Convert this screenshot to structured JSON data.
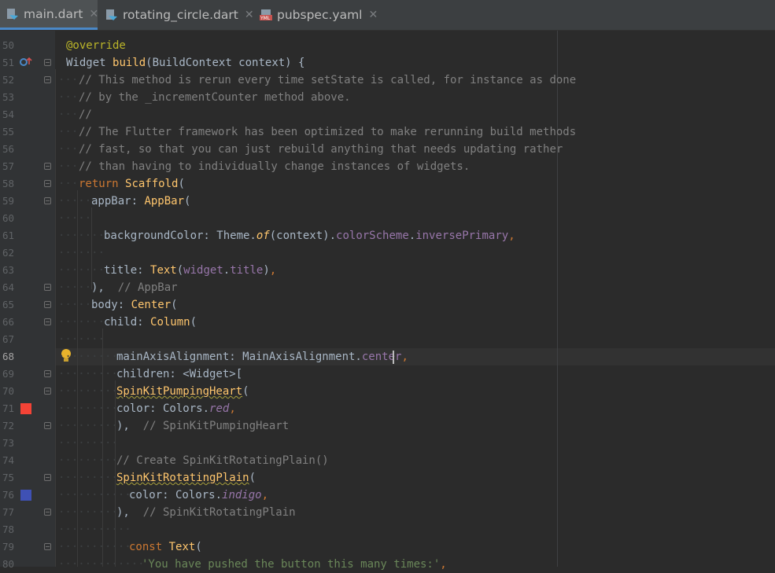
{
  "tabs": [
    {
      "label": "main.dart",
      "active": true,
      "icon": "dart-file-icon"
    },
    {
      "label": "rotating_circle.dart",
      "active": false,
      "icon": "dart-file-icon"
    },
    {
      "label": "pubspec.yaml",
      "active": false,
      "icon": "yaml-file-icon"
    }
  ],
  "editor": {
    "current_line": "68",
    "swatch_colors": {
      "red": "#f44336",
      "indigo": "#3f51b5"
    },
    "lines": [
      {
        "n": "50",
        "code": "@override"
      },
      {
        "n": "51",
        "code": "Widget build(BuildContext context) {"
      },
      {
        "n": "52",
        "code": "// This method is rerun every time setState is called, for instance as done"
      },
      {
        "n": "53",
        "code": "// by the _incrementCounter method above."
      },
      {
        "n": "54",
        "code": "//"
      },
      {
        "n": "55",
        "code": "// The Flutter framework has been optimized to make rerunning build methods"
      },
      {
        "n": "56",
        "code": "// fast, so that you can just rebuild anything that needs updating rather"
      },
      {
        "n": "57",
        "code": "// than having to individually change instances of widgets."
      },
      {
        "n": "58",
        "code": "return Scaffold("
      },
      {
        "n": "59",
        "code": "appBar: AppBar("
      },
      {
        "n": "60",
        "code": ""
      },
      {
        "n": "61",
        "code": "backgroundColor: Theme.of(context).colorScheme.inversePrimary,"
      },
      {
        "n": "62",
        "code": ""
      },
      {
        "n": "63",
        "code": "title: Text(widget.title),"
      },
      {
        "n": "64",
        "code": "),  // AppBar"
      },
      {
        "n": "65",
        "code": "body: Center("
      },
      {
        "n": "66",
        "code": "child: Column("
      },
      {
        "n": "67",
        "code": ""
      },
      {
        "n": "68",
        "code": "mainAxisAlignment: MainAxisAlignment.center,"
      },
      {
        "n": "69",
        "code": "children: <Widget>["
      },
      {
        "n": "70",
        "code": "SpinKitPumpingHeart("
      },
      {
        "n": "71",
        "code": "color: Colors.red,"
      },
      {
        "n": "72",
        "code": "),  // SpinKitPumpingHeart"
      },
      {
        "n": "73",
        "code": ""
      },
      {
        "n": "74",
        "code": "// Create SpinKitRotatingPlain()"
      },
      {
        "n": "75",
        "code": "SpinKitRotatingPlain("
      },
      {
        "n": "76",
        "code": "color: Colors.indigo,"
      },
      {
        "n": "77",
        "code": "),  // SpinKitRotatingPlain"
      },
      {
        "n": "78",
        "code": ""
      },
      {
        "n": "79",
        "code": "const Text("
      },
      {
        "n": "80",
        "code": "'You have pushed the button this many times:',"
      }
    ]
  }
}
